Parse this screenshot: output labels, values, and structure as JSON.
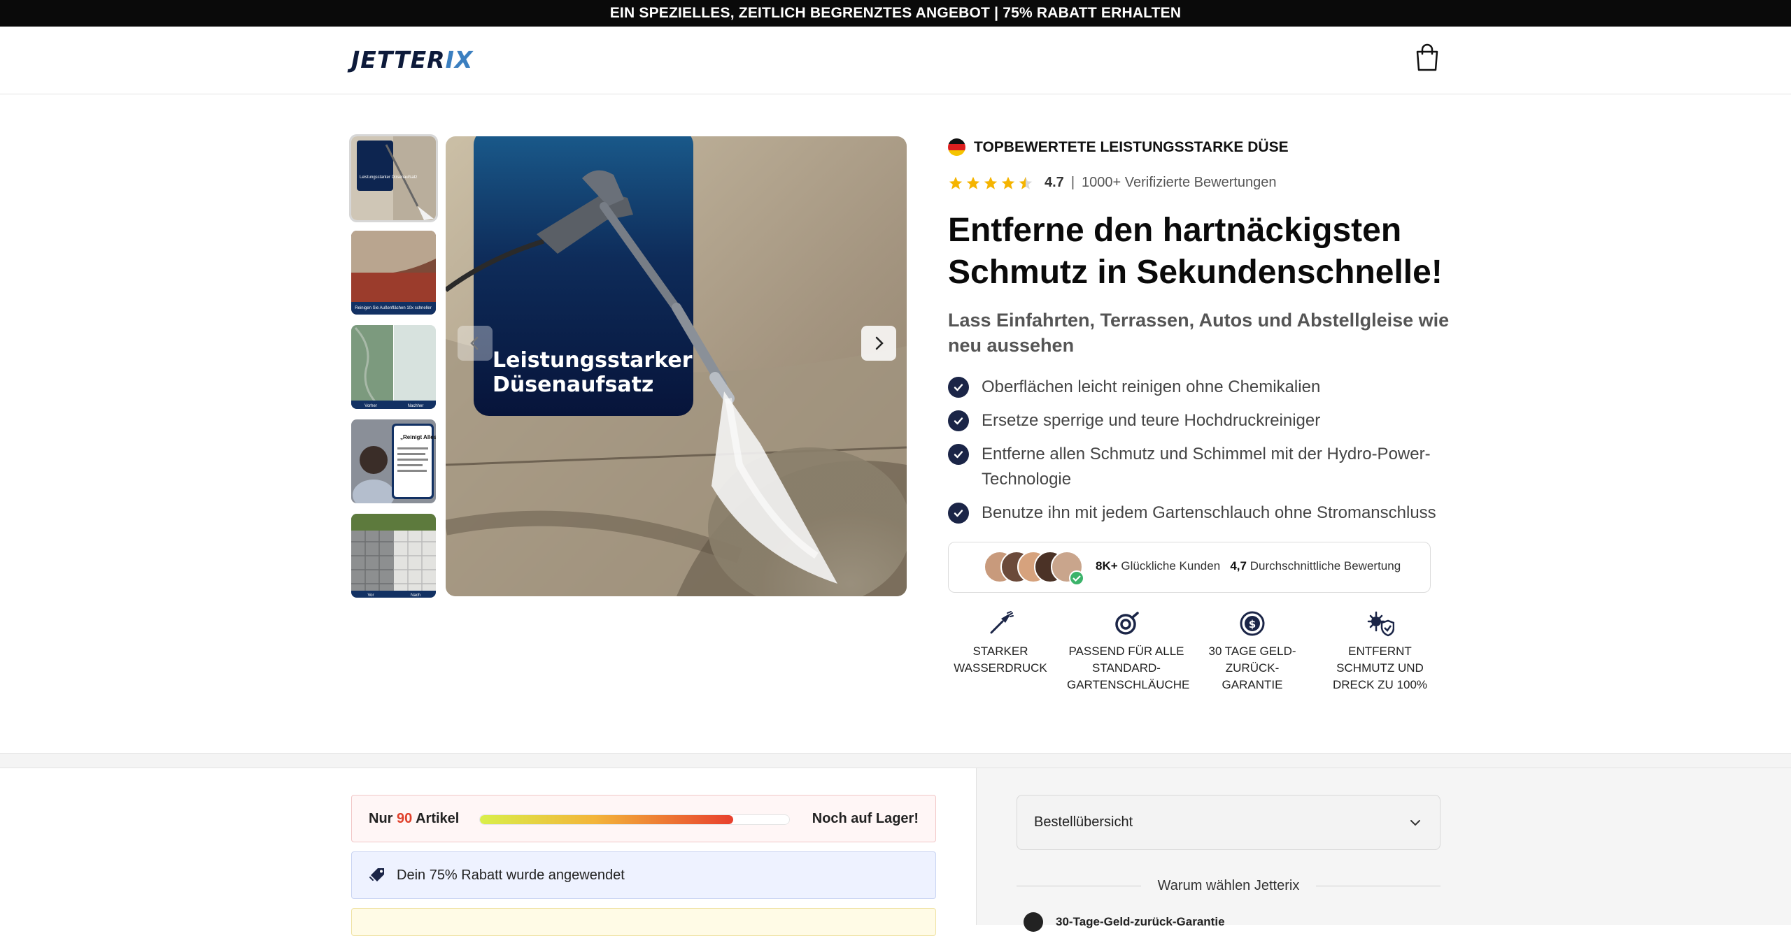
{
  "announcement": "EIN SPEZIELLES, ZEITLICH BEGRENZTES ANGEBOT | 75% RABATT ERHALTEN",
  "header": {
    "logo_main": "JETTER",
    "logo_accent": "IX",
    "cart_icon": "shopping-bag-icon"
  },
  "gallery": {
    "main_image_caption": "Leistungsstarker Düsenaufsatz",
    "thumbnails": [
      {
        "name": "thumb-nozzle",
        "caption": "Leistungsstarker Düsenaufsatz"
      },
      {
        "name": "thumb-red-tiles",
        "caption": "Reinigen Sie Außenflächen 10x schneller"
      },
      {
        "name": "thumb-before-after",
        "caption_left": "Vorher",
        "caption_right": "Nachher"
      },
      {
        "name": "thumb-review",
        "caption": "„Reinigt Alles“"
      },
      {
        "name": "thumb-pavers",
        "caption_left": "Vor",
        "caption_right": "Nach"
      }
    ]
  },
  "product": {
    "badge": "TOPBEWERTETE LEISTUNGSSTARKE DÜSE",
    "rating_value": "4.7",
    "rating_separator": "|",
    "rating_text": "1000+ Verifizierte Bewertungen",
    "stars": 4.5,
    "title": "Entferne den hartnäckigsten Schmutz in Sekundenschnelle!",
    "subtitle": "Lass Einfahrten, Terrassen, Autos und Abstellgleise wie neu aussehen",
    "features": [
      "Oberflächen leicht reinigen ohne Chemikalien",
      "Ersetze sperrige und teure Hochdruckreiniger",
      "Entferne allen Schmutz und Schimmel mit der Hydro-Power-Technologie",
      "Benutze ihn mit jedem Gartenschlauch ohne Stromanschluss"
    ],
    "social_count": "8K+",
    "social_count_label": "Glückliche Kunden",
    "social_rating": "4,7",
    "social_rating_label": "Durchschnittliche Bewertung",
    "usps": [
      {
        "icon": "nozzle-icon",
        "label": "STARKER WASSERDRUCK"
      },
      {
        "icon": "hose-icon",
        "label": "PASSEND FÜR ALLE STANDARD-GARTENSCHLÄUCHE"
      },
      {
        "icon": "money-back-icon",
        "label": "30 TAGE GELD-ZURÜCK-GARANTIE"
      },
      {
        "icon": "germ-shield-icon",
        "label": "ENTFERNT SCHMUTZ UND DRECK ZU 100%"
      }
    ]
  },
  "stock": {
    "prefix": "Nur",
    "count": "90",
    "suffix": "Artikel",
    "status": "Noch auf Lager!",
    "fill_fraction": 0.82
  },
  "discount_text": "Dein 75% Rabatt wurde angewendet",
  "summary": {
    "label": "Bestellübersicht",
    "why_title": "Warum wählen Jetterix",
    "guarantee": "30-Tage-Geld-zurück-Garantie"
  },
  "colors": {
    "navy": "#1b2547",
    "stock_red": "#e0402b",
    "star_gold": "#f5b400"
  }
}
